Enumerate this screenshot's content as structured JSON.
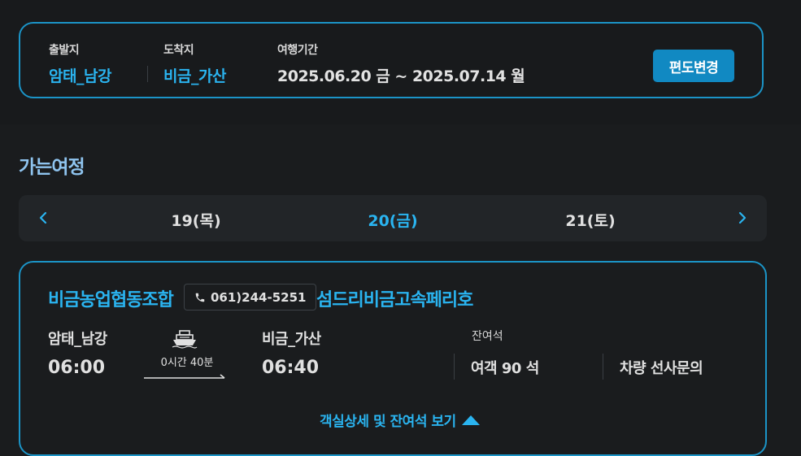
{
  "search_summary": {
    "departure_label": "출발지",
    "departure_value": "암태_남강",
    "arrival_label": "도착지",
    "arrival_value": "비금_가산",
    "period_label": "여행기간",
    "period_value": "2025.06.20 금 ~ 2025.07.14 월",
    "change_button": "편도변경"
  },
  "section_title": "가는여정",
  "date_nav": {
    "dates": [
      {
        "label": "19(목)",
        "active": false
      },
      {
        "label": "20(금)",
        "active": true
      },
      {
        "label": "21(토)",
        "active": false
      }
    ],
    "prev_icon": "chevron-left-icon",
    "next_icon": "chevron-right-icon"
  },
  "voyage": {
    "company": "비금농업협동조합",
    "phone": "061)244-5251",
    "ship_name": "섬드리비금고속페리호",
    "from_port": "암태_남강",
    "from_time": "06:00",
    "duration": "0시간 40분",
    "to_port": "비금_가산",
    "to_time": "06:40",
    "seat_label": "잔여석",
    "passenger_seats": "여객 90 석",
    "vehicle_seats": "차량 선사문의",
    "detail_link": "객실상세 및 잔여석 보기"
  },
  "colors": {
    "accent": "#2ab4f0",
    "border": "#1b94c7",
    "button": "#1189c2",
    "title": "#8fc4ef"
  }
}
